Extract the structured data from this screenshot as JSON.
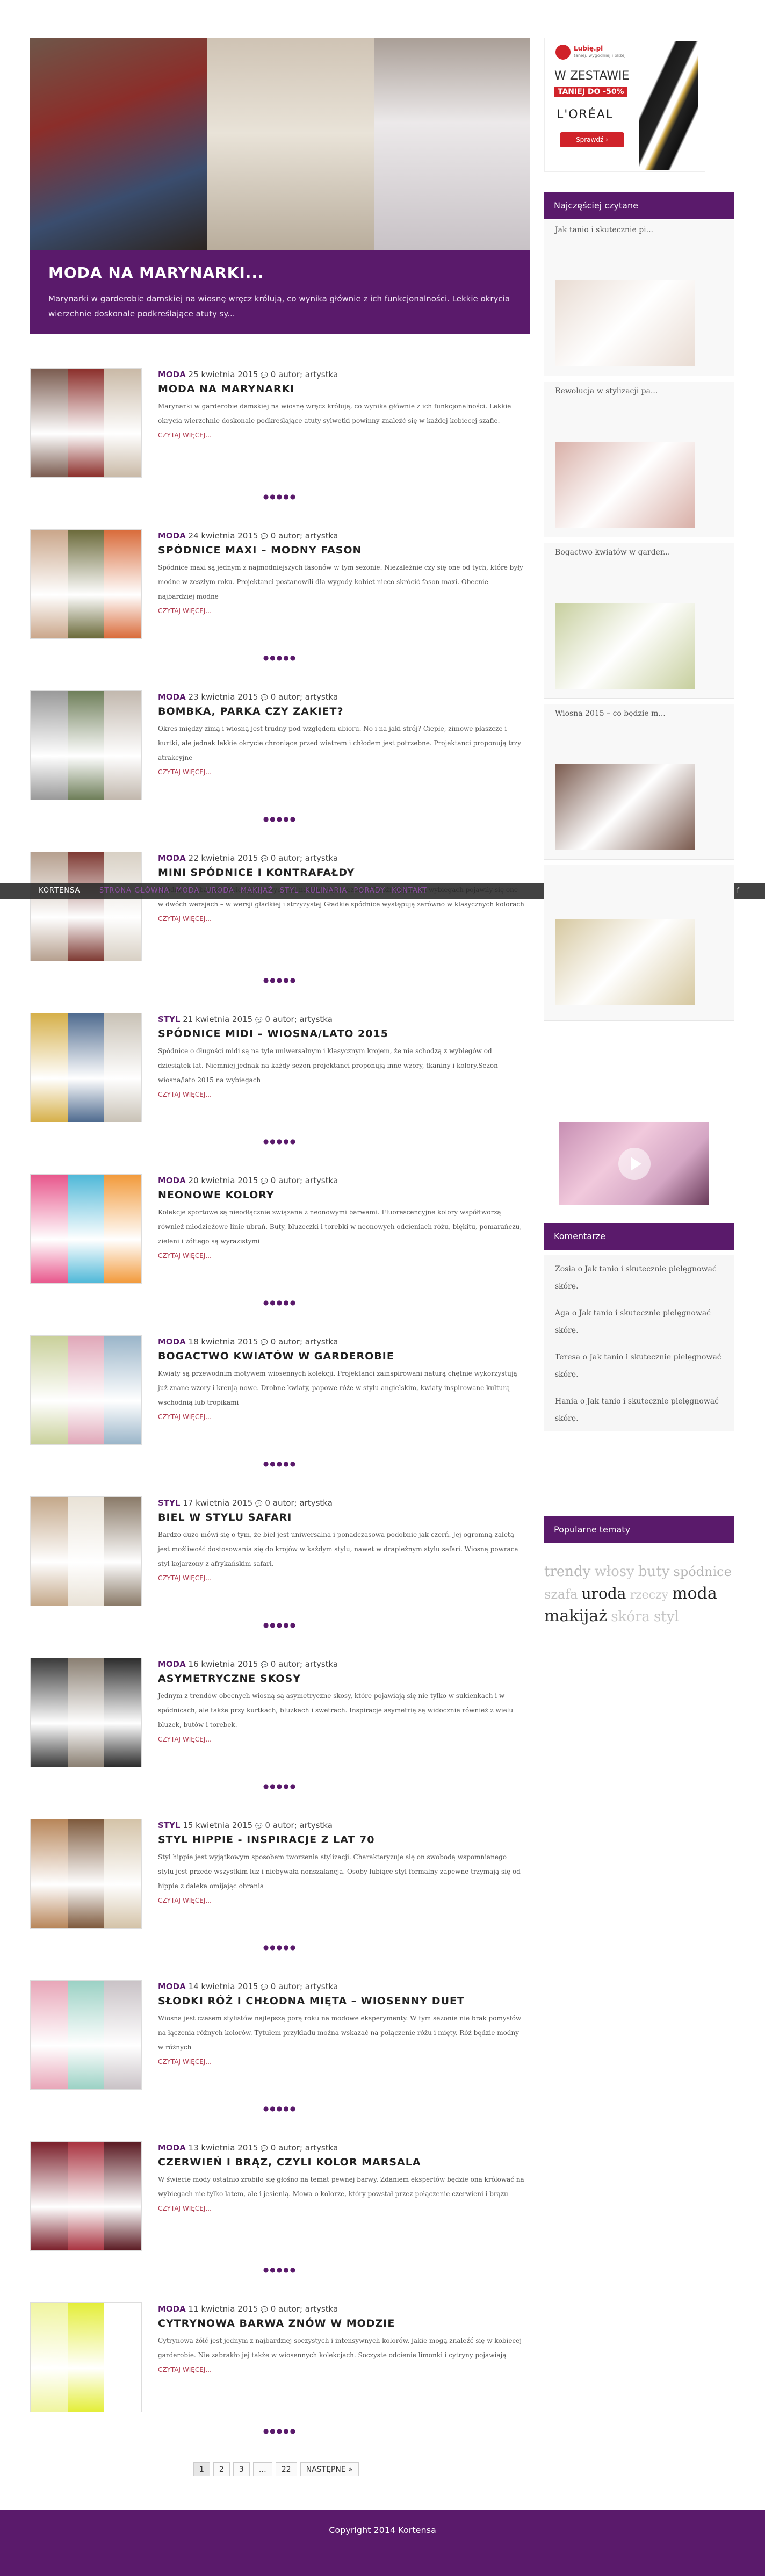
{
  "hero": {
    "title": "MODA NA MARYNARKI...",
    "text": "Marynarki w garderobie damskiej na wiosnę wręcz królują, co wynika głównie z ich funkcjonalności. Lekkie okrycia wierzchnie doskonale podkreślające atuty sy..."
  },
  "nav": {
    "brand": "KORTENSA",
    "items": [
      "STRONA GŁÓWNA",
      "MODA",
      "URODA",
      "MAKIJAŻ",
      "STYL",
      "KULINARIA",
      "PORADY",
      "KONTAKT"
    ],
    "icon_labels": [
      "⌕",
      "f"
    ]
  },
  "posts": [
    {
      "category": "MODA",
      "date": "25 kwietnia 2015",
      "comments": "0",
      "author": "autor; artystka",
      "title": "MODA NA MARYNARKI",
      "excerpt": "Marynarki w garderobie damskiej na wiosnę wręcz królują, co wynika głównie z ich funkcjonalności. Lekkie okrycia wierzchnie doskonale podkreślające atuty sylwetki powinny znaleźć się w każdej kobiecej szafie.",
      "colors": [
        "#7a5b4f",
        "#8b2e2a",
        "#c9b9a6"
      ]
    },
    {
      "category": "MODA",
      "date": "24 kwietnia 2015",
      "comments": "0",
      "author": "autor; artystka",
      "title": "SPÓDNICE MAXI – MODNY FASON",
      "excerpt": "Spódnice maxi są jednym z najmodniejszych fasonów w tym sezonie. Niezależnie czy się one od tych, które były modne w zeszłym roku. Projektanci postanowili dla wygody kobiet nieco skrócić fason maxi. Obecnie najbardziej modne",
      "colors": [
        "#caa68a",
        "#6b6a3a",
        "#d96b3a"
      ]
    },
    {
      "category": "MODA",
      "date": "23 kwietnia 2015",
      "comments": "0",
      "author": "autor; artystka",
      "title": "BOMBKA, PARKA CZY ZAKIET?",
      "excerpt": "Okres między zimą i wiosną jest trudny pod względem ubioru. No i na jaki strój? Ciepłe, zimowe płaszcze i kurtki, ale jednak lekkie okrycie chroniące przed wiatrem i chłodem jest potrzebne. Projektanci proponują trzy atrakcyjne",
      "colors": [
        "#9a9a9a",
        "#6f7f5a",
        "#c2b8ae"
      ]
    },
    {
      "category": "MODA",
      "date": "22 kwietnia 2015",
      "comments": "0",
      "author": "autor; artystka",
      "title": "MINI SPÓDNICE I KONTRAFAŁDY",
      "excerpt": "Spódnice są bardzo kobiecą propozycją na nadchodzące sezony. Wyróżniają się na wybiegach pojawiły się one w dwóch wersjach – w wersji gładkiej i strzyżystej Gładkie spódnice występują zarówno w klasycznych kolorach",
      "colors": [
        "#b6a08f",
        "#7f3b34",
        "#d8d0c4"
      ]
    },
    {
      "category": "STYL",
      "date": "21 kwietnia 2015",
      "comments": "0",
      "author": "autor; artystka",
      "title": "SPÓDNICE MIDI – WIOSNA/LATO 2015",
      "excerpt": "Spódnice o długości midi są na tyle uniwersalnym i klasycznym krojem, że nie schodzą z wybiegów od dziesiątek lat. Niemniej jednak na każdy sezon projektanci proponują inne wzory, tkaniny i kolory.Sezon wiosna/lato 2015 na wybiegach",
      "colors": [
        "#d6b04a",
        "#4f6b8f",
        "#c9c2b6"
      ]
    },
    {
      "category": "MODA",
      "date": "20 kwietnia 2015",
      "comments": "0",
      "author": "autor; artystka",
      "title": "NEONOWE KOLORY",
      "excerpt": "Kolekcje sportowe są nieodłącznie związane z neonowymi barwami. Fluorescencyjne kolory współtworzą również młodzieżowe linie ubrań. Buty, bluzeczki i torebki w neonowych odcieniach różu, błękitu, pomarańczu, zieleni i żółtego są wyrazistymi",
      "colors": [
        "#e8578c",
        "#4fb8d8",
        "#f29a3b"
      ]
    },
    {
      "category": "MODA",
      "date": "18 kwietnia 2015",
      "comments": "0",
      "author": "autor; artystka",
      "title": "BOGACTWO KWIATÓW W GARDEROBIE",
      "excerpt": "Kwiaty są przewodnim motywem wiosennych kolekcji. Projektanci zainspirowani naturą chętnie wykorzystują już znane wzory i kreują nowe. Drobne kwiaty, papowe róże w stylu angielskim, kwiaty inspirowane kulturą wschodnią lub tropikami",
      "colors": [
        "#c9d09a",
        "#e0a7b8",
        "#9ab5c9"
      ]
    },
    {
      "category": "STYL",
      "date": "17 kwietnia 2015",
      "comments": "0",
      "author": "autor; artystka",
      "title": "BIEL W STYLU SAFARI",
      "excerpt": "Bardzo dużo mówi się o tym, że biel jest uniwersalna i ponadczasowa podobnie jak czerń. Jej ogromną zaletą jest możliwość dostosowania się do krojów w każdym stylu, nawet w drapieżnym stylu safari. Wiosną powraca styl kojarzony z afrykańskim safari.",
      "colors": [
        "#c4a88a",
        "#e9e2d6",
        "#8a7a68"
      ]
    },
    {
      "category": "MODA",
      "date": "16 kwietnia 2015",
      "comments": "0",
      "author": "autor; artystka",
      "title": "ASYMETRYCZNE SKOSY",
      "excerpt": "Jednym z trendów obecnych wiosną są asymetryczne skosy, które pojawiają się nie tylko w sukienkach i w spódnicach, ale także przy kurtkach, bluzkach i swetrach. Inspiracje asymetrią są widocznie również z wielu bluzek, butów i torebek.",
      "colors": [
        "#3a3a3a",
        "#8a7f72",
        "#2c2c2c"
      ]
    },
    {
      "category": "STYL",
      "date": "15 kwietnia 2015",
      "comments": "0",
      "author": "autor; artystka",
      "title": "STYL HIPPIE - INSPIRACJE Z LAT 70",
      "excerpt": "Styl hippie jest wyjątkowym sposobem tworzenia stylizacji. Charakteryzuje się on swobodą wspomnianego stylu jest przede wszystkim luz i niebywała nonszalancja. Osoby lubiące styl formalny zapewne trzymają się od hippie z daleka omijając obrania",
      "colors": [
        "#b8865a",
        "#7f5b3e",
        "#d4c3a8"
      ]
    },
    {
      "category": "MODA",
      "date": "14 kwietnia 2015",
      "comments": "0",
      "author": "autor; artystka",
      "title": "SŁODKI RÓŻ I CHŁODNA MIĘTA – WIOSENNY DUET",
      "excerpt": "Wiosna jest czasem stylistów najlepszą porą roku na modowe eksperymenty. W tym sezonie nie brak pomysłów na łączenia różnych kolorów. Tytułem przykładu można wskazać na połączenie różu i mięty. Róż będzie modny w różnych",
      "colors": [
        "#e8a6b8",
        "#9bd1c4",
        "#c9c2c6"
      ]
    },
    {
      "category": "MODA",
      "date": "13 kwietnia 2015",
      "comments": "0",
      "author": "autor; artystka",
      "title": "CZERWIEŃ I BRĄZ, CZYLI KOLOR MARSALA",
      "excerpt": "W świecie mody ostatnio zrobiło się głośno na temat pewnej barwy. Zdaniem ekspertów będzie ona królować na wybiegach nie tylko latem, ale i jesienią. Mowa o kolorze, który powstał przez połączenie czerwieni i brązu",
      "colors": [
        "#7a1f2a",
        "#a8323f",
        "#5a1a22"
      ]
    },
    {
      "category": "MODA",
      "date": "11 kwietnia 2015",
      "comments": "0",
      "author": "autor; artystka",
      "title": "CYTRYNOWA BARWA ZNÓW W MODZIE",
      "excerpt": "Cytrynowa żółć jest jednym z najbardziej soczystych i intensywnych kolorów, jakie mogą znaleźć się w kobiecej garderobie. Nie zabrakło jej także w wiosennych kolekcjach. Soczyste odcienie limonki i cytryny pojawiają",
      "colors": [
        "#f0f5a0",
        "#e4ee3a",
        "#ffffff"
      ]
    }
  ],
  "post_more_label": "CZYTAJ WIĘCEJ...",
  "post_separator": "●●●●●",
  "sidebar": {
    "ad": {
      "brand": "Lubię.pl",
      "sub": "taniej, wygodniej i bliżej",
      "line1": "W ZESTAWIE",
      "line2": "TANIEJ DO -50%",
      "line3": "L'ORÉAL",
      "button": "Sprawdź ›"
    },
    "recent_heading": "Najczęściej czytane",
    "recent": [
      {
        "title": "Jak tanio i skutecznie pi...",
        "color": "#e9dcd3"
      },
      {
        "title": "Rewolucja w stylizacji pa...",
        "color": "#d9b0a8"
      },
      {
        "title": "Bogactwo kwiatów w garder...",
        "color": "#c7cf9e"
      },
      {
        "title": "Wiosna 2015 – co będzie m...",
        "color": "#7a5a4e"
      },
      {
        "title": "",
        "color": "#d6c8a0"
      }
    ],
    "comments_heading": "Komentarze",
    "comments": [
      "Zosia o Jak tanio i skutecznie pielęgnować skórę.",
      "Aga o Jak tanio i skutecznie pielęgnować skórę.",
      "Teresa o Jak tanio i skutecznie pielęgnować skórę.",
      "Hania o Jak tanio i skutecznie pielęgnować skórę."
    ],
    "tags_heading": "Popularne tematy",
    "tags": [
      {
        "label": "trendy",
        "size": 26,
        "color": "#b9b9b9"
      },
      {
        "label": "włosy",
        "size": 26,
        "color": "#c4c4c4"
      },
      {
        "label": "buty",
        "size": 26,
        "color": "#bdbdbd"
      },
      {
        "label": "spódnice",
        "size": 24,
        "color": "#b4b4b4"
      },
      {
        "label": "szafa",
        "size": 24,
        "color": "#c0c0c0"
      },
      {
        "label": "uroda",
        "size": 28,
        "color": "#222222"
      },
      {
        "label": "rzeczy",
        "size": 22,
        "color": "#c6c6c6"
      },
      {
        "label": "moda",
        "size": 30,
        "color": "#222222"
      },
      {
        "label": "makijaż",
        "size": 30,
        "color": "#333333"
      },
      {
        "label": "skóra",
        "size": 26,
        "color": "#c8c8c8"
      },
      {
        "label": "styl",
        "size": 26,
        "color": "#c2c2c2"
      }
    ]
  },
  "pager": {
    "pages": [
      "1",
      "2",
      "3",
      "…",
      "22"
    ],
    "next": "NASTĘPNE »"
  },
  "footer": {
    "text": "Copyright 2014 Kortensa"
  }
}
